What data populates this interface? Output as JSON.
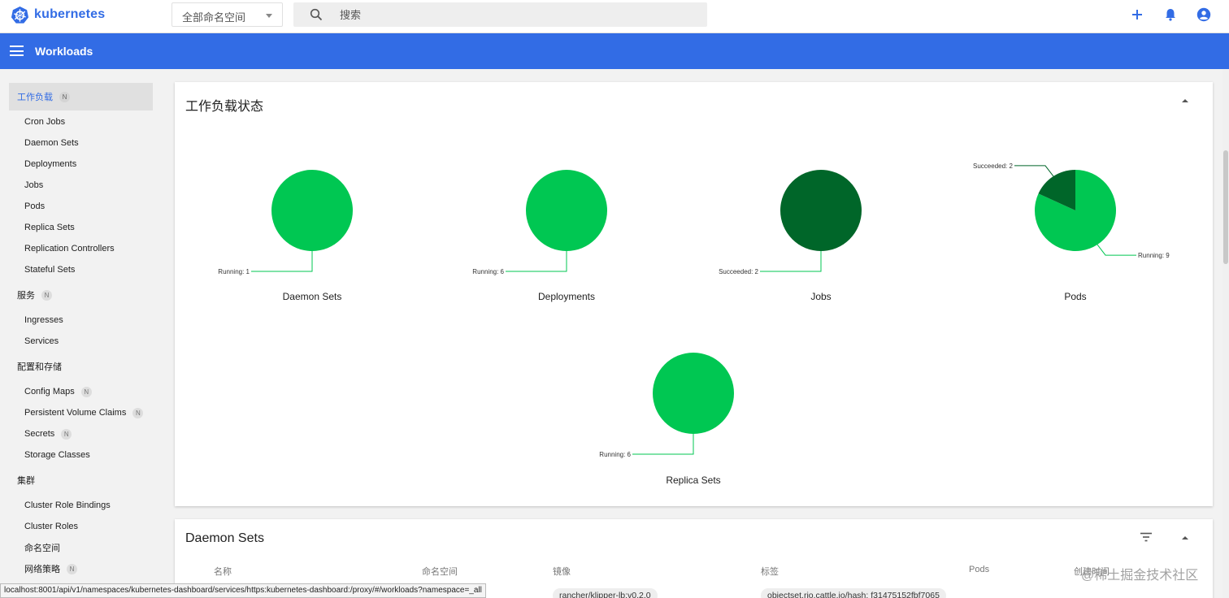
{
  "app": {
    "name": "kubernetes"
  },
  "topbar": {
    "namespace_selected": "全部命名空间",
    "search_placeholder": "搜索"
  },
  "header": {
    "title": "Workloads"
  },
  "sidebar": {
    "categories": [
      {
        "label": "工作负载",
        "badge": "N"
      },
      {
        "label": "服务",
        "badge": "N"
      },
      {
        "label": "配置和存储"
      },
      {
        "label": "集群"
      }
    ],
    "workloads_items": [
      {
        "label": "Cron Jobs"
      },
      {
        "label": "Daemon Sets"
      },
      {
        "label": "Deployments"
      },
      {
        "label": "Jobs"
      },
      {
        "label": "Pods"
      },
      {
        "label": "Replica Sets"
      },
      {
        "label": "Replication Controllers"
      },
      {
        "label": "Stateful Sets"
      }
    ],
    "service_items": [
      {
        "label": "Ingresses"
      },
      {
        "label": "Services"
      }
    ],
    "config_items": [
      {
        "label": "Config Maps",
        "badge": "N"
      },
      {
        "label": "Persistent Volume Claims",
        "badge": "N"
      },
      {
        "label": "Secrets",
        "badge": "N"
      },
      {
        "label": "Storage Classes"
      }
    ],
    "cluster_items": [
      {
        "label": "Cluster Role Bindings"
      },
      {
        "label": "Cluster Roles"
      },
      {
        "label": "命名空间"
      },
      {
        "label": "网络策略",
        "badge": "N"
      }
    ]
  },
  "status_card": {
    "title": "工作负载状态"
  },
  "colors": {
    "running": "#00c752",
    "succeeded": "#006629",
    "accent": "#326ce5"
  },
  "chart_data": [
    {
      "type": "pie",
      "title": "Daemon Sets",
      "slices": [
        {
          "name": "Running",
          "value": 1
        }
      ],
      "labels": [
        "Running: 1"
      ]
    },
    {
      "type": "pie",
      "title": "Deployments",
      "slices": [
        {
          "name": "Running",
          "value": 6
        }
      ],
      "labels": [
        "Running: 6"
      ]
    },
    {
      "type": "pie",
      "title": "Jobs",
      "slices": [
        {
          "name": "Succeeded",
          "value": 2
        }
      ],
      "labels": [
        "Succeeded: 2"
      ]
    },
    {
      "type": "pie",
      "title": "Pods",
      "slices": [
        {
          "name": "Running",
          "value": 9
        },
        {
          "name": "Succeeded",
          "value": 2
        }
      ],
      "labels": [
        "Running: 9",
        "Succeeded: 2"
      ]
    },
    {
      "type": "pie",
      "title": "Replica Sets",
      "slices": [
        {
          "name": "Running",
          "value": 6
        }
      ],
      "labels": [
        "Running: 6"
      ]
    }
  ],
  "daemonsets_card": {
    "title": "Daemon Sets",
    "columns": [
      "名称",
      "命名空间",
      "镜像",
      "标签",
      "Pods",
      "创建时间"
    ],
    "first_row": {
      "image": "rancher/klipper-lb:v0.2.0",
      "label": "objectset.rio.cattle.io/hash: f31475152fbf7065"
    }
  },
  "statusbar": {
    "url": "localhost:8001/api/v1/namespaces/kubernetes-dashboard/services/https:kubernetes-dashboard:/proxy/#/workloads?namespace=_all"
  },
  "watermark": "@稀土掘金技术社区"
}
